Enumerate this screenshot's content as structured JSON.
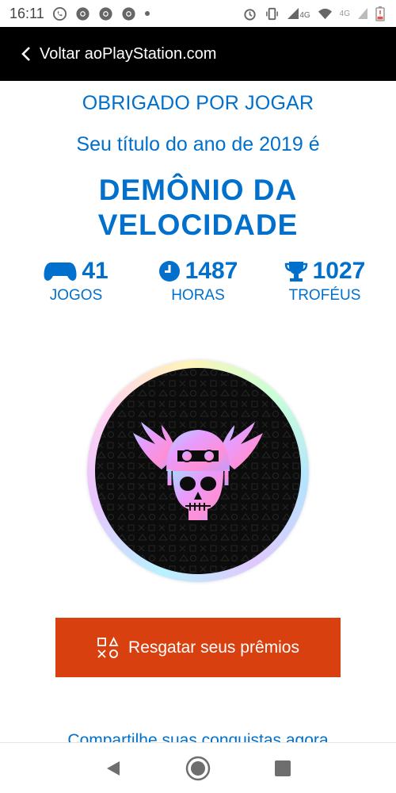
{
  "status_bar": {
    "time": "16:11",
    "network_label_1": "4G",
    "network_label_2": "4G"
  },
  "nav": {
    "back_label": "Voltar aoPlayStation.com"
  },
  "wrapup": {
    "thanks": "OBRIGADO POR JOGAR",
    "title_line": "Seu título do ano de 2019 é",
    "badge_title": "DEMÔNIO DA VELOCIDADE"
  },
  "stats": [
    {
      "icon": "gamepad-icon",
      "value": "41",
      "label": "JOGOS"
    },
    {
      "icon": "clock-icon",
      "value": "1487",
      "label": "HORAS"
    },
    {
      "icon": "trophy-icon",
      "value": "1027",
      "label": "TROFÉUS"
    }
  ],
  "emblem": {
    "icon": "winged-skull-helmet-icon"
  },
  "cta": {
    "label": "Resgatar seus prêmios",
    "icon": "playstation-shapes-icon"
  },
  "share": {
    "label": "Compartilhe suas conquistas agora"
  },
  "colors": {
    "accent_blue": "#0070cc",
    "cta_orange": "#d8410f",
    "nav_black": "#000000"
  }
}
